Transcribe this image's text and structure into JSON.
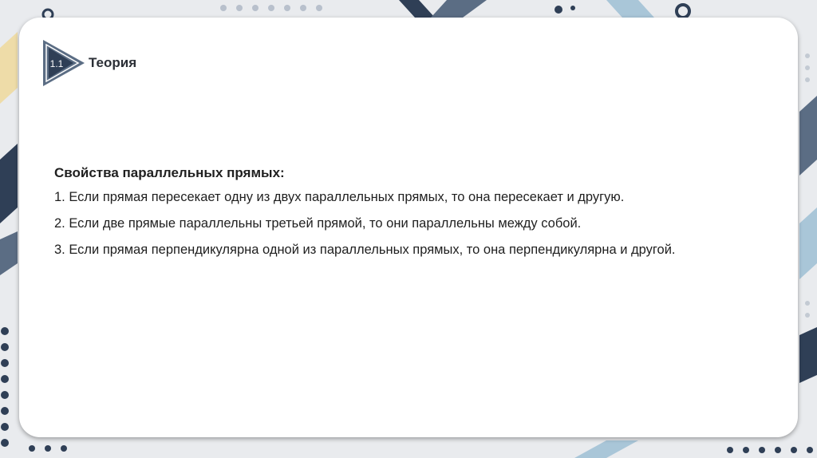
{
  "section": {
    "number": "1.1",
    "title": "Теория"
  },
  "content": {
    "heading": "Свойства параллельных прямых:",
    "items": [
      "1. Если прямая пересекает одну из двух параллельных прямых, то она пересекает и другую.",
      "2. Если две прямые параллельны третьей прямой, то они параллельны между собой.",
      "3. Если прямая перпендикулярна одной из параллельных прямых, то она перпендикулярна и другой."
    ]
  },
  "colors": {
    "navy": "#2f3f56",
    "slate": "#5b6d84",
    "light_blue": "#a9c6d8",
    "yellow": "#f2d27a",
    "card": "#ffffff"
  }
}
